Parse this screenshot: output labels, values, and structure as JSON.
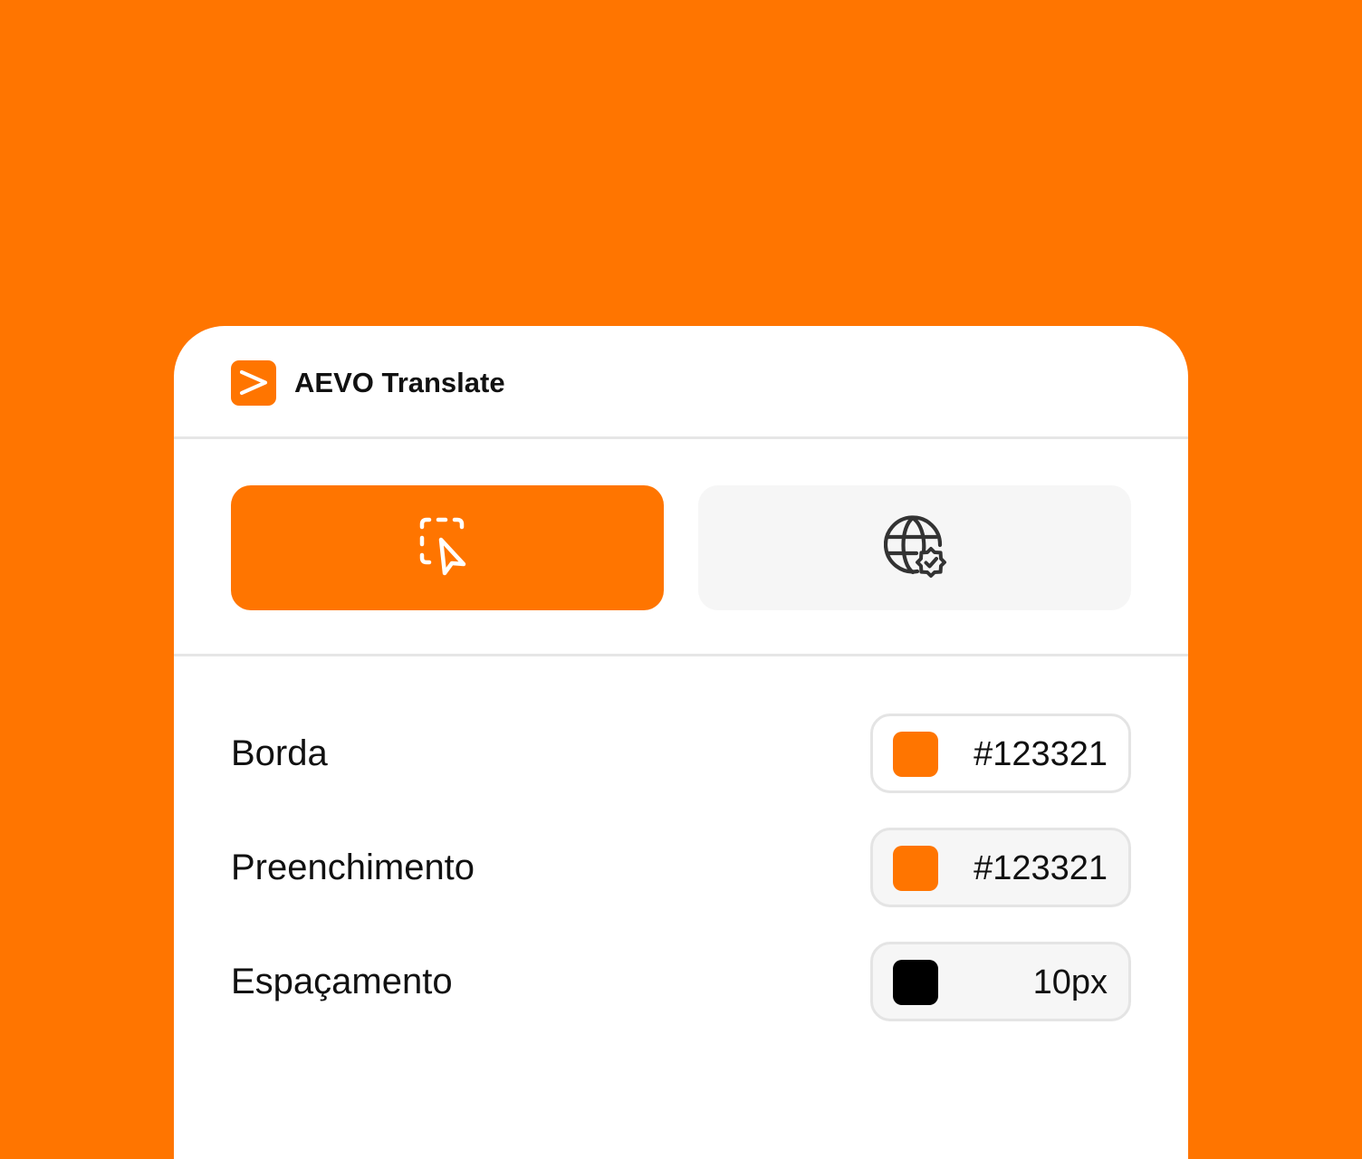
{
  "colors": {
    "background": "#FF7500",
    "accent": "#FF7500",
    "panel": "#FFFFFF",
    "button_inactive": "#F6F6F6",
    "text": "#111111",
    "divider": "#E6E6E6"
  },
  "header": {
    "logo_icon": "chevron-right-logo-icon",
    "app_title": "AEVO Translate"
  },
  "modes": [
    {
      "icon": "select-area-cursor-icon",
      "active": true
    },
    {
      "icon": "globe-verified-icon",
      "active": false
    }
  ],
  "properties": [
    {
      "label": "Borda",
      "value": "#123321",
      "swatch_color": "#FF7500"
    },
    {
      "label": "Preenchimento",
      "value": "#123321",
      "swatch_color": "#FF7500"
    },
    {
      "label": "Espaçamento",
      "value": "10px",
      "swatch_color": "#000000"
    }
  ]
}
